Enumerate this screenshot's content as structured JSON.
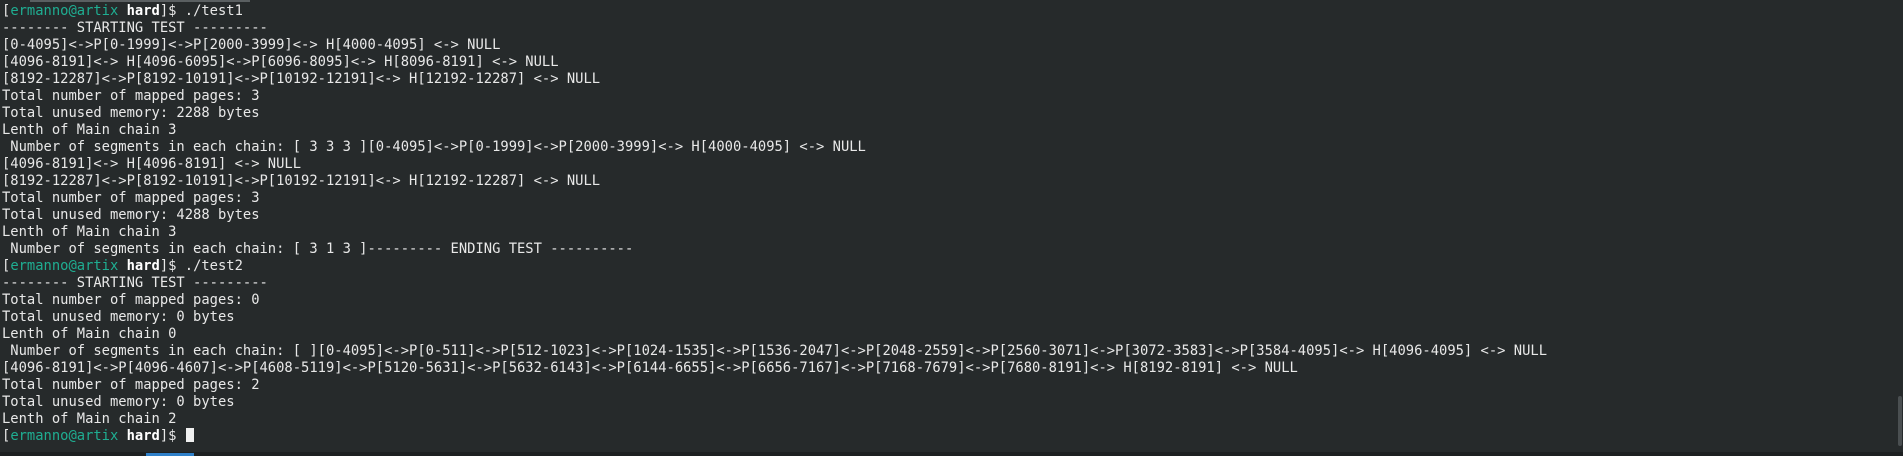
{
  "prompt": {
    "user_host": "ermanno@artix",
    "cwd": "hard"
  },
  "lines": [
    {
      "type": "prompt",
      "command": "./test1"
    },
    {
      "type": "output",
      "text": "-------- STARTING TEST ---------"
    },
    {
      "type": "output",
      "text": "[0-4095]<->P[0-1999]<->P[2000-3999]<-> H[4000-4095] <-> NULL"
    },
    {
      "type": "output",
      "text": "[4096-8191]<-> H[4096-6095]<->P[6096-8095]<-> H[8096-8191] <-> NULL"
    },
    {
      "type": "output",
      "text": "[8192-12287]<->P[8192-10191]<->P[10192-12191]<-> H[12192-12287] <-> NULL"
    },
    {
      "type": "output",
      "text": "Total number of mapped pages: 3"
    },
    {
      "type": "output",
      "text": "Total unused memory: 2288 bytes"
    },
    {
      "type": "output",
      "text": "Lenth of Main chain 3"
    },
    {
      "type": "output",
      "text": " Number of segments in each chain: [ 3 3 3 ][0-4095]<->P[0-1999]<->P[2000-3999]<-> H[4000-4095] <-> NULL"
    },
    {
      "type": "output",
      "text": "[4096-8191]<-> H[4096-8191] <-> NULL"
    },
    {
      "type": "output",
      "text": "[8192-12287]<->P[8192-10191]<->P[10192-12191]<-> H[12192-12287] <-> NULL"
    },
    {
      "type": "output",
      "text": "Total number of mapped pages: 3"
    },
    {
      "type": "output",
      "text": "Total unused memory: 4288 bytes"
    },
    {
      "type": "output",
      "text": "Lenth of Main chain 3"
    },
    {
      "type": "output",
      "text": " Number of segments in each chain: [ 3 1 3 ]--------- ENDING TEST ----------"
    },
    {
      "type": "prompt",
      "command": "./test2"
    },
    {
      "type": "output",
      "text": "-------- STARTING TEST ---------"
    },
    {
      "type": "output",
      "text": "Total number of mapped pages: 0"
    },
    {
      "type": "output",
      "text": "Total unused memory: 0 bytes"
    },
    {
      "type": "output",
      "text": "Lenth of Main chain 0"
    },
    {
      "type": "output",
      "text": " Number of segments in each chain: [ ][0-4095]<->P[0-511]<->P[512-1023]<->P[1024-1535]<->P[1536-2047]<->P[2048-2559]<->P[2560-3071]<->P[3072-3583]<->P[3584-4095]<-> H[4096-4095] <-> NULL"
    },
    {
      "type": "output",
      "text": "[4096-8191]<->P[4096-4607]<->P[4608-5119]<->P[5120-5631]<->P[5632-6143]<->P[6144-6655]<->P[6656-7167]<->P[7168-7679]<->P[7680-8191]<-> H[8192-8191] <-> NULL"
    },
    {
      "type": "output",
      "text": "Total number of mapped pages: 2"
    },
    {
      "type": "output",
      "text": "Total unused memory: 0 bytes"
    },
    {
      "type": "output",
      "text": "Lenth of Main chain 2"
    },
    {
      "type": "prompt",
      "command": "",
      "cursor": true
    }
  ]
}
